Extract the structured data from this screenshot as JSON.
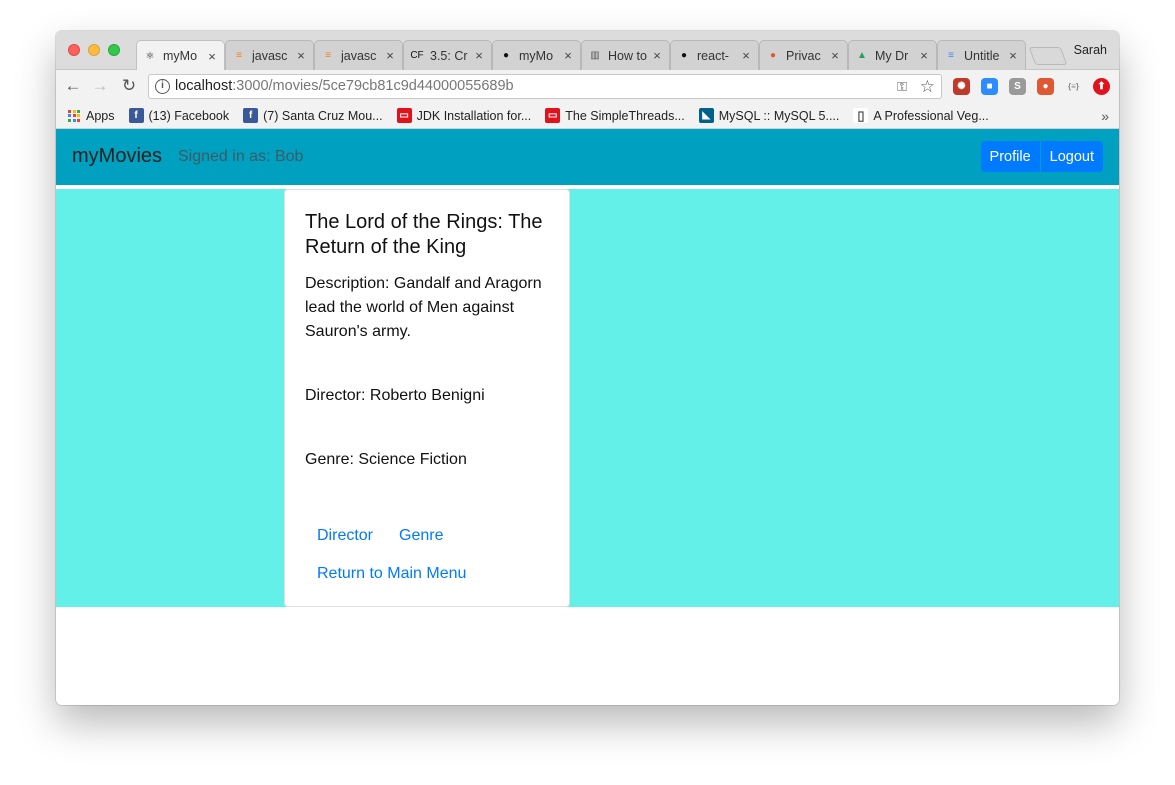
{
  "browser": {
    "profile_name": "Sarah",
    "tabs": [
      {
        "label": "myMo",
        "icon": "react-icon",
        "color": "#222222",
        "glyph": "⚛",
        "active": true
      },
      {
        "label": "javasc",
        "icon": "stackoverflow-icon",
        "color": "#f48024",
        "glyph": "≡"
      },
      {
        "label": "javasc",
        "icon": "stackoverflow-icon",
        "color": "#f48024",
        "glyph": "≡"
      },
      {
        "label": "3.5: Cr",
        "icon": "cf-icon",
        "color": "#111111",
        "glyph": "CF"
      },
      {
        "label": "myMo",
        "icon": "github-icon",
        "color": "#111111",
        "glyph": "●"
      },
      {
        "label": "How to",
        "icon": "book-icon",
        "color": "#555555",
        "glyph": "▥"
      },
      {
        "label": "react-",
        "icon": "github-icon",
        "color": "#111111",
        "glyph": "●"
      },
      {
        "label": "Privac",
        "icon": "duckduckgo-icon",
        "color": "#de5833",
        "glyph": "●"
      },
      {
        "label": "My Dr",
        "icon": "google-drive-icon",
        "color": "#1fa463",
        "glyph": "▲"
      },
      {
        "label": "Untitle",
        "icon": "google-docs-icon",
        "color": "#4285f4",
        "glyph": "≡"
      }
    ],
    "url_host": "localhost",
    "url_path": ":3000/movies/5ce79cb81c9d44000055689b",
    "bookmarks": [
      {
        "label": "Apps",
        "icon": "apps-grid-icon"
      },
      {
        "label": "(13) Facebook",
        "icon": "facebook-icon",
        "color": "#3b5998",
        "glyph": "f"
      },
      {
        "label": "(7) Santa Cruz Mou...",
        "icon": "facebook-icon",
        "color": "#3b5998",
        "glyph": "f"
      },
      {
        "label": "JDK Installation for...",
        "icon": "oracle-icon",
        "color": "#e0121c",
        "glyph": "▭"
      },
      {
        "label": "The SimpleThreads...",
        "icon": "oracle-icon",
        "color": "#e0121c",
        "glyph": "▭"
      },
      {
        "label": "MySQL :: MySQL 5....",
        "icon": "mysql-icon",
        "color": "#00618a",
        "glyph": "◣"
      },
      {
        "label": "A Professional Veg...",
        "icon": "document-icon",
        "color": "#ffffff",
        "glyph": "▯"
      }
    ],
    "extensions": [
      {
        "name": "extension-ladybug-icon",
        "color": "#c0392b",
        "glyph": "✺"
      },
      {
        "name": "extension-zoom-icon",
        "color": "#2d8cff",
        "glyph": "■"
      },
      {
        "name": "extension-s-icon",
        "color": "#9a9a9a",
        "glyph": "S"
      },
      {
        "name": "extension-duckduckgo-icon",
        "color": "#de5833",
        "glyph": "●"
      },
      {
        "name": "extension-json-icon",
        "color": "#f2f2f2",
        "glyph": "{≡}"
      },
      {
        "name": "extension-upload-icon",
        "color": "#e0121c",
        "glyph": "⬆"
      }
    ]
  },
  "app": {
    "brand": "myMovies",
    "signed_in": "Signed in as: Bob",
    "nav_profile": "Profile",
    "nav_logout": "Logout",
    "accent_color": "#00a0c0",
    "background_color": "#62f0e8"
  },
  "movie": {
    "title": "The Lord of the Rings: The Return of the King",
    "description": "Description: Gandalf and Aragorn lead the world of Men against Sauron's army.",
    "director": "Director: Roberto Benigni",
    "genre": "Genre: Science Fiction",
    "link_director": "Director",
    "link_genre": "Genre",
    "link_return": "Return to Main Menu"
  }
}
